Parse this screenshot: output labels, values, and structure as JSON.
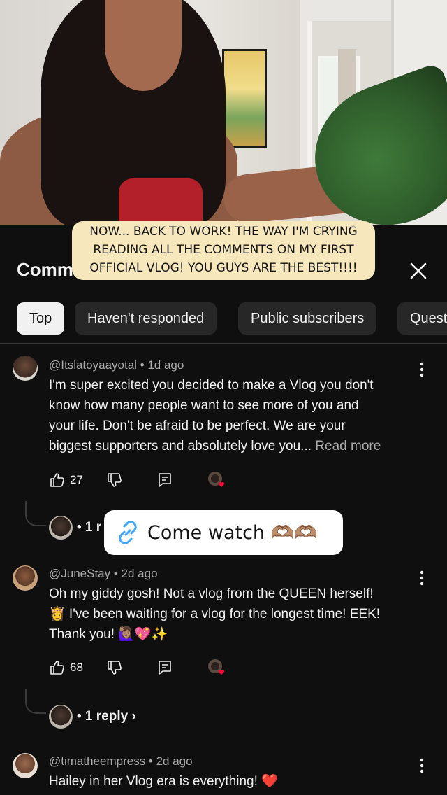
{
  "caption": {
    "lines": [
      "NOW... BACK TO WORK! THE WAY I'M CRYING",
      "READING ALL THE COMMENTS ON MY FIRST",
      "OFFICIAL VLOG! YOU GUYS ARE THE BEST!!!!"
    ]
  },
  "sheet": {
    "title": "Comm",
    "close_icon": "close-icon"
  },
  "chips": [
    {
      "label": "Top"
    },
    {
      "label": "Haven't responded"
    },
    {
      "label": "Public subscribers"
    },
    {
      "label": "Quest"
    }
  ],
  "comments": [
    {
      "author": "@Itslatoyaayotal",
      "age": "1d ago",
      "meta": "@Itslatoyaayotal • 1d ago",
      "lines": [
        "I'm super excited you decided to make a Vlog you don't",
        "know how many people want to see more of you and",
        "your life. Don't be afraid to be perfect. We are your",
        "biggest supporters and absolutely love you..."
      ],
      "read_more": "Read more",
      "likes": "27",
      "replies": "• 1 r"
    },
    {
      "author": "@JuneStay",
      "age": "2d ago",
      "meta": "@JuneStay • 2d ago",
      "lines": [
        "Oh my giddy gosh! Not a vlog from the QUEEN herself!",
        "👸 I've been waiting for a vlog for the longest time! EEK!",
        "Thank you! 🙋🏽‍♀️💖✨"
      ],
      "likes": "68",
      "replies": "• 1 reply ›"
    },
    {
      "author": "@timatheempress",
      "age": "2d ago",
      "meta": "@timatheempress • 2d ago",
      "lines": [
        "Hailey in her Vlog era is everything! ❤️"
      ]
    }
  ],
  "link_popup": {
    "text": "Come watch 🫶🏽🫶🏽",
    "icon": "link-icon"
  },
  "colors": {
    "background": "#0f0f0f",
    "chip": "#272727",
    "chip_active": "#f1f1f1",
    "caption_bg": "#f6e7bd",
    "link_blue": "#3ea6ff",
    "heart_red": "#ff0033"
  }
}
